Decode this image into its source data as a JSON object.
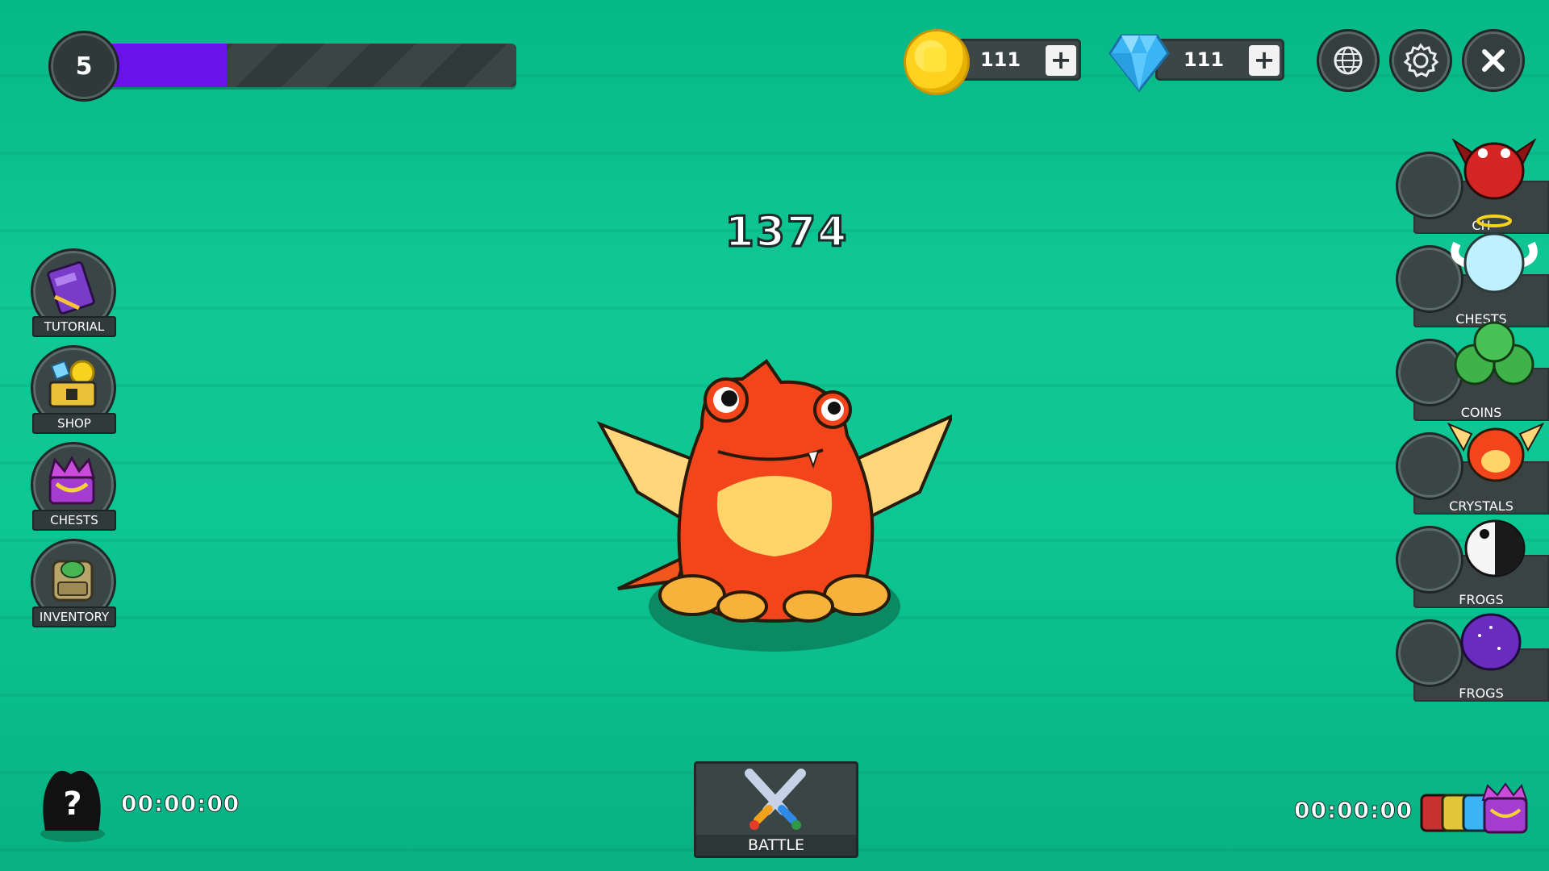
{
  "level": {
    "value": "5",
    "progress": 0.31,
    "fill_color": "#6a12e8"
  },
  "currencies": {
    "coins": {
      "value": "111",
      "icon": "coin-icon",
      "plus": "+"
    },
    "crystals": {
      "value": "111",
      "icon": "crystal-icon",
      "plus": "+"
    }
  },
  "top_buttons": [
    {
      "name": "language-button",
      "icon": "language-icon"
    },
    {
      "name": "settings-button",
      "icon": "gear-icon"
    },
    {
      "name": "close-button",
      "icon": "close-icon"
    }
  ],
  "score": "1374",
  "left_menu": [
    {
      "label": "TUTORIAL",
      "icon": "book-icon"
    },
    {
      "label": "SHOP",
      "icon": "shop-chest-icon"
    },
    {
      "label": "CHESTS",
      "icon": "chest-icon"
    },
    {
      "label": "INVENTORY",
      "icon": "backpack-icon"
    }
  ],
  "right_offers": [
    {
      "label": "CH",
      "icon": "devil-frog-icon"
    },
    {
      "label": "CHESTS",
      "icon": "angel-frog-icon"
    },
    {
      "label": "COINS",
      "icon": "frog-pile-icon"
    },
    {
      "label": "CRYSTALS",
      "icon": "dragon-frog-icon"
    },
    {
      "label": "FROGS",
      "icon": "panda-frog-icon"
    },
    {
      "label": "FROGS",
      "icon": "galaxy-frog-icon"
    }
  ],
  "bottom": {
    "left_timer": "00:00:00",
    "right_timer": "00:00:00",
    "battle_label": "BATTLE"
  },
  "colors": {
    "background": "#0cc693",
    "panel": "#394343",
    "frog_body": "#f2451c"
  }
}
